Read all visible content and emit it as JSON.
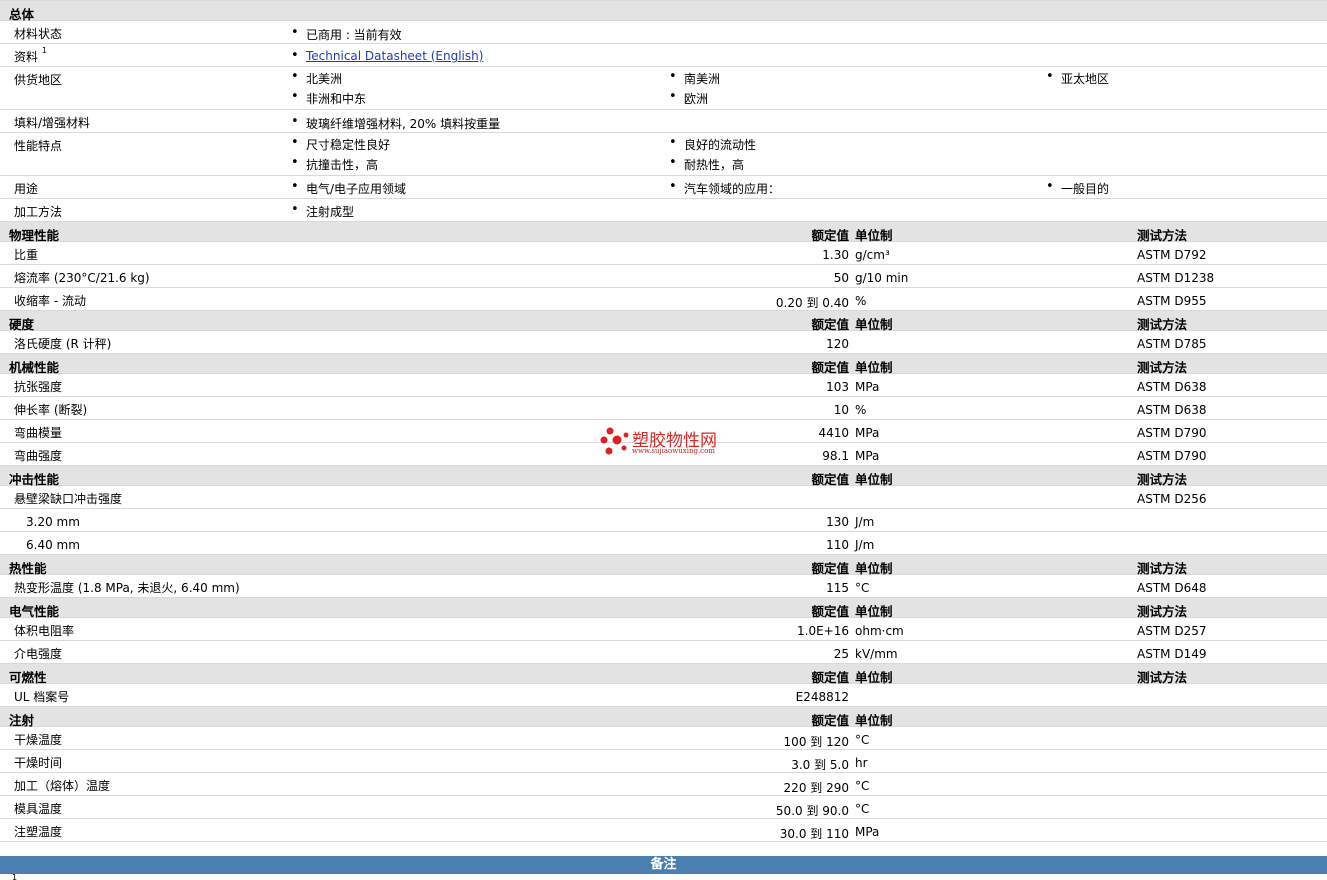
{
  "general": {
    "title": "总体",
    "status_label": "材料状态",
    "status_value": "已商用 : 当前有效",
    "doc_label": "资料",
    "doc_sup": "1",
    "doc_link": "Technical Datasheet (English)",
    "regions_label": "供货地区",
    "regions": [
      "北美洲",
      "南美洲",
      "亚太地区",
      "非洲和中东",
      "欧洲"
    ],
    "filler_label": "填料/增强材料",
    "filler_value": "玻璃纤维增强材料, 20% 填料按重量",
    "features_label": "性能特点",
    "features": [
      "尺寸稳定性良好",
      "良好的流动性",
      "抗撞击性，高",
      "耐热性，高"
    ],
    "uses_label": "用途",
    "uses": [
      "电气/电子应用领域",
      "汽车领域的应用：",
      "一般目的"
    ],
    "process_label": "加工方法",
    "process_value": "注射成型"
  },
  "col_headers": {
    "value": "额定值",
    "unit": "单位制",
    "method": "测试方法"
  },
  "sections": {
    "physical": {
      "title": "物理性能",
      "rows": [
        {
          "label": "比重",
          "value": "1.30",
          "unit": "g/cm³",
          "method": "ASTM D792"
        },
        {
          "label": "熔流率  (230°C/21.6 kg)",
          "value": "50",
          "unit": "g/10 min",
          "method": "ASTM D1238"
        },
        {
          "label": "收缩率  - 流动",
          "value": "0.20 到  0.40",
          "unit": "%",
          "method": "ASTM D955"
        }
      ]
    },
    "hardness": {
      "title": "硬度",
      "rows": [
        {
          "label": "洛氏硬度  (R 计秤)",
          "value": "120",
          "unit": "",
          "method": "ASTM D785"
        }
      ]
    },
    "mechanical": {
      "title": "机械性能",
      "rows": [
        {
          "label": "抗张强度",
          "value": "103",
          "unit": "MPa",
          "method": "ASTM D638"
        },
        {
          "label": "伸长率  (断裂)",
          "value": "10",
          "unit": "%",
          "method": "ASTM D638"
        },
        {
          "label": "弯曲模量",
          "value": "4410",
          "unit": "MPa",
          "method": "ASTM D790"
        },
        {
          "label": "弯曲强度",
          "value": "98.1",
          "unit": "MPa",
          "method": "ASTM D790"
        }
      ]
    },
    "impact": {
      "title": "冲击性能",
      "main_label": "悬壁梁缺口冲击强度",
      "main_method": "ASTM D256",
      "rows": [
        {
          "label": "3.20 mm",
          "value": "130",
          "unit": "J/m"
        },
        {
          "label": "6.40 mm",
          "value": "110",
          "unit": "J/m"
        }
      ]
    },
    "thermal": {
      "title": "热性能",
      "rows": [
        {
          "label": "热变形温度  (1.8 MPa, 未退火, 6.40 mm)",
          "value": "115",
          "unit": "°C",
          "method": "ASTM D648"
        }
      ]
    },
    "electrical": {
      "title": "电气性能",
      "rows": [
        {
          "label": "体积电阻率",
          "value": "1.0E+16",
          "unit": "ohm·cm",
          "method": "ASTM D257"
        },
        {
          "label": "介电强度",
          "value": "25",
          "unit": "kV/mm",
          "method": "ASTM D149"
        }
      ]
    },
    "flammability": {
      "title": "可燃性",
      "rows": [
        {
          "label": "UL 档案号",
          "value": "E248812",
          "unit": "",
          "method": ""
        }
      ]
    },
    "injection": {
      "title": "注射",
      "rows": [
        {
          "label": "干燥温度",
          "value": "100 到  120",
          "unit": "°C"
        },
        {
          "label": "干燥时间",
          "value": "3.0 到  5.0",
          "unit": "hr"
        },
        {
          "label": "加工（熔体）温度",
          "value": "220 到  290",
          "unit": "°C"
        },
        {
          "label": "模具温度",
          "value": "50.0 到  90.0",
          "unit": "°C"
        },
        {
          "label": "注塑温度",
          "value": "30.0 到  110",
          "unit": "MPa"
        }
      ]
    }
  },
  "notes_title": "备注",
  "footnote": "1",
  "watermark": {
    "name": "塑胶物性网",
    "url": "www.sujiaowuxing.com",
    "color": "#e02020"
  }
}
